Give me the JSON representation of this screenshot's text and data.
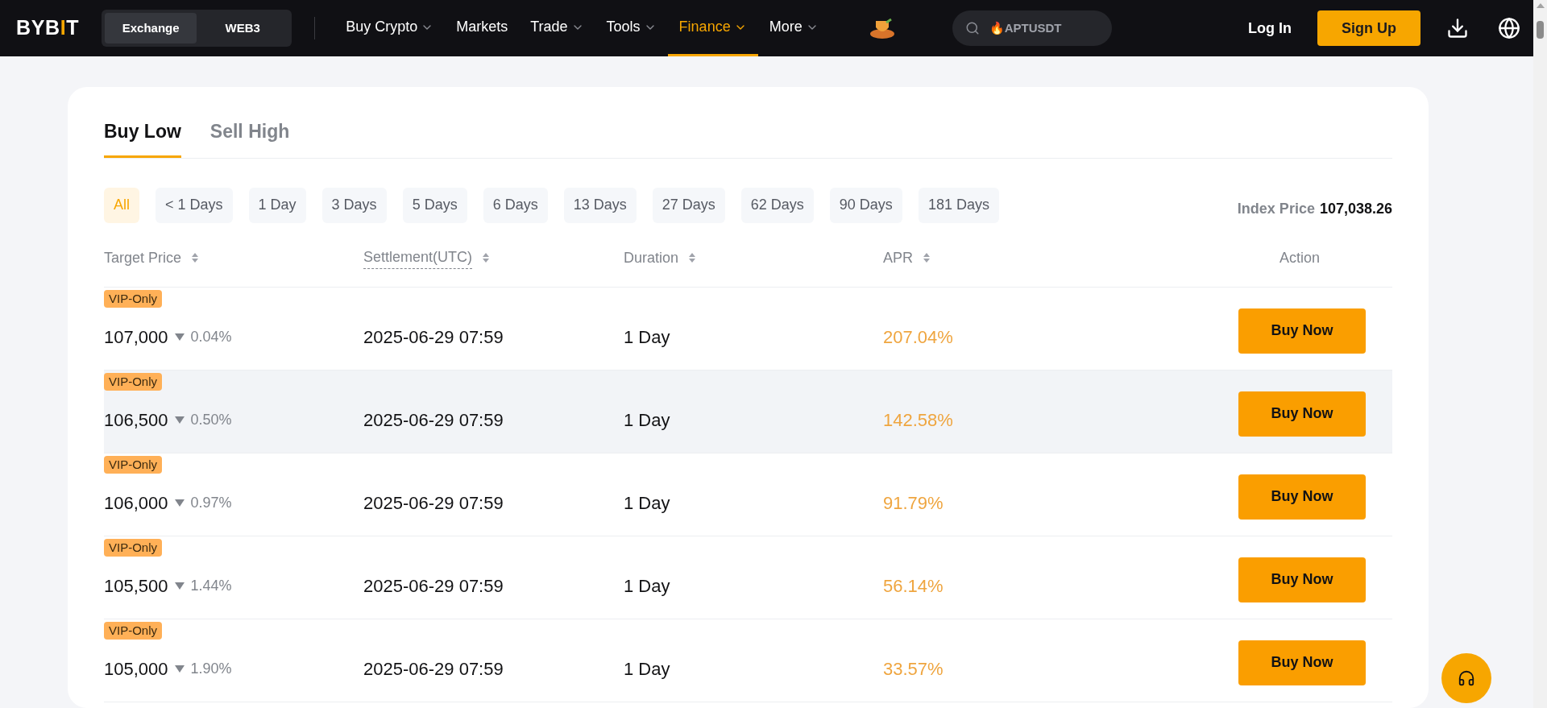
{
  "nav": {
    "logo": [
      {
        "text": "BYB",
        "accent": false
      },
      {
        "text": "I",
        "accent": true
      },
      {
        "text": "T",
        "accent": false
      }
    ],
    "switch": [
      {
        "label": "Exchange",
        "selected": true
      },
      {
        "label": "WEB3",
        "selected": false
      }
    ],
    "items": [
      {
        "label": "Buy Crypto",
        "dropdown": true,
        "selected": false
      },
      {
        "label": "Markets",
        "dropdown": false,
        "selected": false
      },
      {
        "label": "Trade",
        "dropdown": true,
        "selected": false
      },
      {
        "label": "Tools",
        "dropdown": true,
        "selected": false
      },
      {
        "label": "Finance",
        "dropdown": true,
        "selected": true
      },
      {
        "label": "More",
        "dropdown": true,
        "selected": false
      }
    ],
    "search": {
      "placeholder": "🔥APTUSDT"
    },
    "login": "Log In",
    "signup": "Sign Up"
  },
  "tabs": [
    {
      "label": "Buy Low",
      "selected": true
    },
    {
      "label": "Sell High",
      "selected": false
    }
  ],
  "filters": [
    {
      "label": "All",
      "selected": true
    },
    {
      "label": "< 1 Days",
      "selected": false
    },
    {
      "label": "1 Day",
      "selected": false
    },
    {
      "label": "3 Days",
      "selected": false
    },
    {
      "label": "5 Days",
      "selected": false
    },
    {
      "label": "6 Days",
      "selected": false
    },
    {
      "label": "13 Days",
      "selected": false
    },
    {
      "label": "27 Days",
      "selected": false
    },
    {
      "label": "62 Days",
      "selected": false
    },
    {
      "label": "90 Days",
      "selected": false
    },
    {
      "label": "181 Days",
      "selected": false
    }
  ],
  "index_price": {
    "label": "Index Price",
    "value": "107,038.26"
  },
  "table": {
    "columns": [
      {
        "label": "Target Price",
        "sortable": true,
        "dashed": false
      },
      {
        "label": "Settlement(UTC)",
        "sortable": true,
        "dashed": true
      },
      {
        "label": "Duration",
        "sortable": true,
        "dashed": false
      },
      {
        "label": "APR",
        "sortable": true,
        "dashed": false
      },
      {
        "label": "Action",
        "sortable": false,
        "dashed": false
      }
    ],
    "rows": [
      {
        "badge": "VIP-Only",
        "price": "107,000",
        "change": "0.04%",
        "settlement": "2025-06-29 07:59",
        "duration": "1 Day",
        "apr": "207.04%",
        "action": "Buy Now",
        "highlighted": false
      },
      {
        "badge": "VIP-Only",
        "price": "106,500",
        "change": "0.50%",
        "settlement": "2025-06-29 07:59",
        "duration": "1 Day",
        "apr": "142.58%",
        "action": "Buy Now",
        "highlighted": true
      },
      {
        "badge": "VIP-Only",
        "price": "106,000",
        "change": "0.97%",
        "settlement": "2025-06-29 07:59",
        "duration": "1 Day",
        "apr": "91.79%",
        "action": "Buy Now",
        "highlighted": false
      },
      {
        "badge": "VIP-Only",
        "price": "105,500",
        "change": "1.44%",
        "settlement": "2025-06-29 07:59",
        "duration": "1 Day",
        "apr": "56.14%",
        "action": "Buy Now",
        "highlighted": false
      },
      {
        "badge": "VIP-Only",
        "price": "105,000",
        "change": "1.90%",
        "settlement": "2025-06-29 07:59",
        "duration": "1 Day",
        "apr": "33.57%",
        "action": "Buy Now",
        "highlighted": false
      }
    ]
  }
}
